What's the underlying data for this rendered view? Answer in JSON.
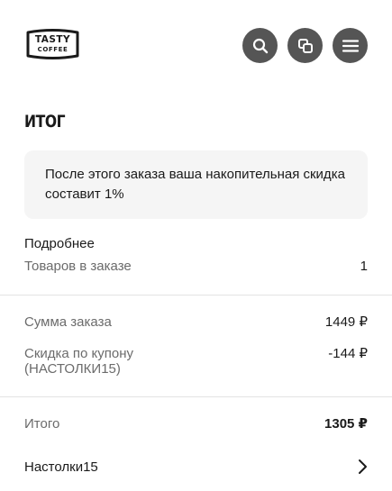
{
  "header": {
    "logo": {
      "line1": "TASTY",
      "line2": "COFFEE"
    },
    "icons": {
      "search": "search-icon",
      "compare": "compare-icon",
      "menu": "menu-icon"
    }
  },
  "page_title": "ИТОГ",
  "info_box": {
    "text": "После этого заказа ваша накопительная скидка составит 1%"
  },
  "details": {
    "label": "Подробнее",
    "items_label": "Товаров в заказе",
    "items_value": "1"
  },
  "summary": {
    "order_sum_label": "Сумма заказа",
    "order_sum_value": "1449 ₽",
    "coupon_discount_label": "Скидка по купону (НАСТОЛКИ15)",
    "coupon_discount_value": "-144 ₽",
    "total_label": "Итого",
    "total_value": "1305 ₽"
  },
  "coupon": {
    "label": "Настолки15"
  },
  "colors": {
    "icon_button_bg": "#555555",
    "info_box_bg": "#f5f5f5",
    "muted_text": "#6b6b6b",
    "divider": "#e3e3e3"
  }
}
